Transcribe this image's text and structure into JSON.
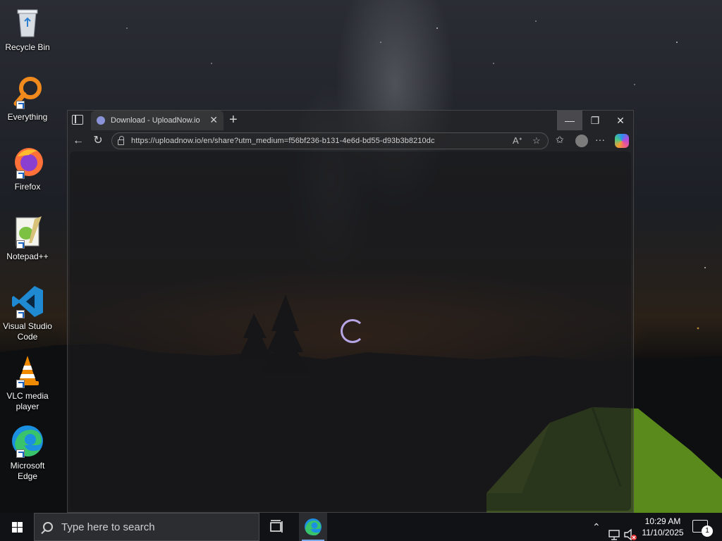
{
  "desktop": {
    "icons": [
      {
        "label": "Recycle Bin",
        "icon": "recycle-bin-icon"
      },
      {
        "label": "Everything",
        "icon": "everything-icon"
      },
      {
        "label": "Firefox",
        "icon": "firefox-icon"
      },
      {
        "label": "Notepad++",
        "icon": "notepad-plus-plus-icon"
      },
      {
        "label": "Visual Studio Code",
        "icon": "vscode-icon"
      },
      {
        "label": "VLC media player",
        "icon": "vlc-icon"
      },
      {
        "label": "Microsoft Edge",
        "icon": "edge-icon"
      }
    ]
  },
  "browser": {
    "tab_title": "Download - UploadNow.io",
    "url": "https://uploadnow.io/en/share?utm_medium=f56bf236-b131-4e6d-bd55-d93b3b8210dc",
    "state": "loading",
    "accent_spinner": "#b7a6e6"
  },
  "taskbar": {
    "search_placeholder": "Type here to search",
    "time": "10:29 AM",
    "date": "11/10/2025",
    "notification_count": "1",
    "pinned": [
      "task-view",
      "microsoft-edge"
    ]
  }
}
